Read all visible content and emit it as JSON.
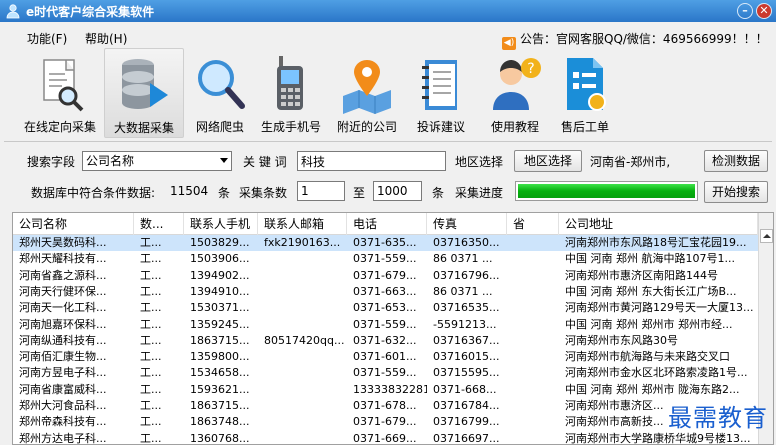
{
  "window": {
    "title": "e时代客户综合采集软件"
  },
  "menu": {
    "items": [
      "功能(F)",
      "帮助(H)"
    ],
    "notice": "公告：官网客服QQ/微信：469566999！！！"
  },
  "toolbar": {
    "items": [
      {
        "label": "在线定向采集",
        "icon": "document-search-icon"
      },
      {
        "label": "大数据采集",
        "icon": "database-icon"
      },
      {
        "label": "网络爬虫",
        "icon": "magnifier-icon"
      },
      {
        "label": "生成手机号",
        "icon": "phone-icon"
      },
      {
        "label": "附近的公司",
        "icon": "map-pin-icon"
      },
      {
        "label": "投诉建议",
        "icon": "notebook-icon"
      },
      {
        "label": "使用教程",
        "icon": "help-user-icon"
      },
      {
        "label": "售后工单",
        "icon": "ticket-icon"
      }
    ],
    "active_index": 1
  },
  "search": {
    "field_label": "搜索字段",
    "field_value": "公司名称",
    "keyword_label": "关 键 词",
    "keyword_value": "科技",
    "region_label": "地区选择",
    "region_button": "地区选择",
    "region_value": "河南省-郑州市,",
    "check_button": "检测数据",
    "match_label": "数据库中符合条件数据:",
    "match_count": "11504",
    "unit1": "条",
    "collect_label": "采集条数",
    "from_value": "1",
    "to_label": "至",
    "to_value": "1000",
    "unit2": "条",
    "progress_label": "采集进度",
    "progress": 1.0,
    "start_button": "开始搜索"
  },
  "table": {
    "columns": [
      "公司名称",
      "数...",
      "联系人手机",
      "联系人邮箱",
      "电话",
      "传真",
      "省",
      "公司地址"
    ],
    "rows": [
      [
        "郑州天昊数码科...",
        "工...",
        "1503829...",
        "fxk2190163...",
        "0371-635...",
        "03716350...",
        "",
        "河南郑州市东风路18号汇宝花园19..."
      ],
      [
        "郑州天耀科技有...",
        "工...",
        "1503906...",
        "",
        "0371-559...",
        "86 0371 ...",
        "",
        "中国 河南 郑州  航海中路107号1..."
      ],
      [
        "河南省鑫之源科...",
        "工...",
        "1394902...",
        "",
        "0371-679...",
        "03716796...",
        "",
        "河南郑州市惠济区南阳路144号"
      ],
      [
        "河南天行健环保...",
        "工...",
        "1394910...",
        "",
        "0371-663...",
        "86 0371 ...",
        "",
        "中国 河南 郑州  东大街长江广场B..."
      ],
      [
        "河南天一化工科...",
        "工...",
        "1530371...",
        "",
        "0371-653...",
        "03716535...",
        "",
        "河南郑州市黄河路129号天一大厦13..."
      ],
      [
        "河南旭嘉环保科...",
        "工...",
        "1359245...",
        "",
        "0371-559...",
        "-5591213...",
        "",
        "中国 河南 郑州 郑州市 郑州市经..."
      ],
      [
        "河南纵通科技有...",
        "工...",
        "1863715...",
        "80517420qq...",
        "0371-632...",
        "03716367...",
        "",
        "河南郑州市东风路30号"
      ],
      [
        "河南佰汇康生物...",
        "工...",
        "1359800...",
        "",
        "0371-601...",
        "03716015...",
        "",
        "河南郑州市航海路与未来路交叉口"
      ],
      [
        "河南方昱电子科...",
        "工...",
        "1534658...",
        "",
        "0371-559...",
        "03715595...",
        "",
        "河南郑州市金水区北环路索凌路1号..."
      ],
      [
        "河南省康富威科...",
        "工...",
        "1593621...",
        "",
        "13333832281",
        "0371-668...",
        "",
        "中国 河南 郑州 郑州市 陇海东路2..."
      ],
      [
        "郑州大河食品科...",
        "工...",
        "1863715...",
        "",
        "0371-678...",
        "03716784...",
        "",
        "河南郑州市惠济区..."
      ],
      [
        "郑州帝森科技有...",
        "工...",
        "1863748...",
        "",
        "0371-679...",
        "03716799...",
        "",
        "河南郑州市高新技..."
      ],
      [
        "郑州方达电子科...",
        "工...",
        "1360768...",
        "",
        "0371-669...",
        "03716697...",
        "",
        "河南郑州市大学路康桥华城9号楼13..."
      ]
    ],
    "selected_row": 0
  },
  "watermark": "最需教育"
}
